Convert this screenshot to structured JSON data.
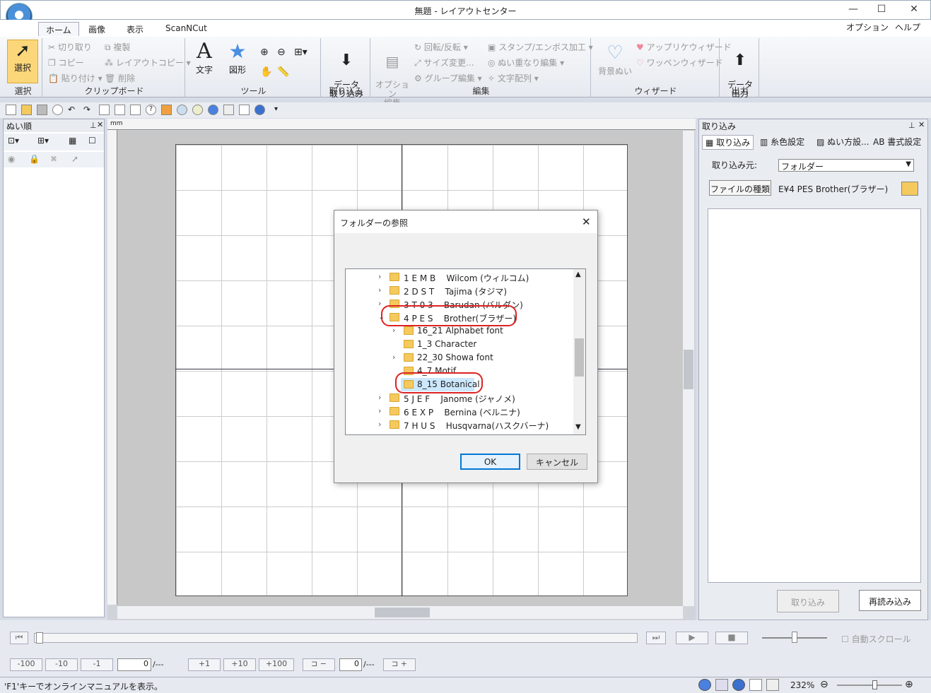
{
  "window": {
    "title": "無題 - レイアウトセンター"
  },
  "tabs": [
    "ホーム",
    "画像",
    "表示",
    "ScanNCut"
  ],
  "menu_right": {
    "option": "オプション",
    "help": "ヘルプ"
  },
  "ribbon": {
    "select": {
      "label": "選択",
      "group": "選択"
    },
    "clipboard": {
      "cut": "切り取り",
      "copy": "コピー",
      "paste": "貼り付け",
      "duplicate": "複製",
      "layout_copy": "レイアウトコピー",
      "delete": "削除",
      "group": "クリップボード"
    },
    "tools": {
      "text": "文字",
      "shape": "図形",
      "group": "ツール"
    },
    "import": {
      "label": "データ\n取り込み",
      "group": "取り込み"
    },
    "edit": {
      "option_edit": "オプション\n編集",
      "rotate_flip": "回転/反転",
      "resize": "サイズ変更...",
      "group_edit": "グループ編集",
      "stamp": "スタンプ/エンボス加工",
      "overlap": "ぬい重なり編集",
      "text_array": "文字配列",
      "group": "編集"
    },
    "wizard": {
      "bg": "背景ぬい",
      "applique": "アップリケウィザード",
      "patch": "ワッペンウィザード",
      "group": "ウィザード"
    },
    "output": {
      "label": "データ\n出力",
      "group": "出力"
    }
  },
  "left_panel": {
    "title": "ぬい順"
  },
  "right_panel": {
    "title": "取り込み",
    "tabs": [
      "取り込み",
      "糸色設定",
      "ぬい方設...",
      "AB 書式設定"
    ],
    "source_label": "取り込み元:",
    "source_value": "フォルダー",
    "filetype_button": "ファイルの種類",
    "filetype_value": "E¥4 PES   Brother(ブラザー)",
    "import_button": "取り込み",
    "reload_button": "再読み込み"
  },
  "ruler": {
    "unit": "mm"
  },
  "dialog": {
    "title": "フォルダーの参照",
    "items": [
      {
        "text": "1 E M B    Wilcom (ウィルコム)",
        "level": 0
      },
      {
        "text": "2 D S T    Tajima (タジマ)",
        "level": 0
      },
      {
        "text": "3 T 0 3    Barudan (バルダン)",
        "level": 0
      },
      {
        "text": "4 P E S    Brother(ブラザー)",
        "level": 0
      },
      {
        "text": "16_21 Alphabet font",
        "level": 1
      },
      {
        "text": "1_3 Character",
        "level": 1
      },
      {
        "text": "22_30 Showa font",
        "level": 1
      },
      {
        "text": "4_7 Motif",
        "level": 1
      },
      {
        "text": "8_15 Botanical",
        "level": 1
      },
      {
        "text": "5 J E F    Janome (ジャノメ)",
        "level": 0
      },
      {
        "text": "6 E X P    Bernina (ベルニナ)",
        "level": 0
      },
      {
        "text": "7 H U S    Husqvarna(ハスクバーナ)",
        "level": 0
      }
    ],
    "ok": "OK",
    "cancel": "キャンセル"
  },
  "bottom": {
    "autoscroll": "自動スクロール",
    "steps": [
      "-100",
      "-10",
      "-1",
      "+1",
      "+10",
      "+100"
    ],
    "counter1": "0",
    "counter1_suffix": "/---",
    "counter2": "0",
    "counter2_suffix": "/---"
  },
  "status": {
    "hint": "'F1'キーでオンラインマニュアルを表示。",
    "zoom": "232%"
  }
}
